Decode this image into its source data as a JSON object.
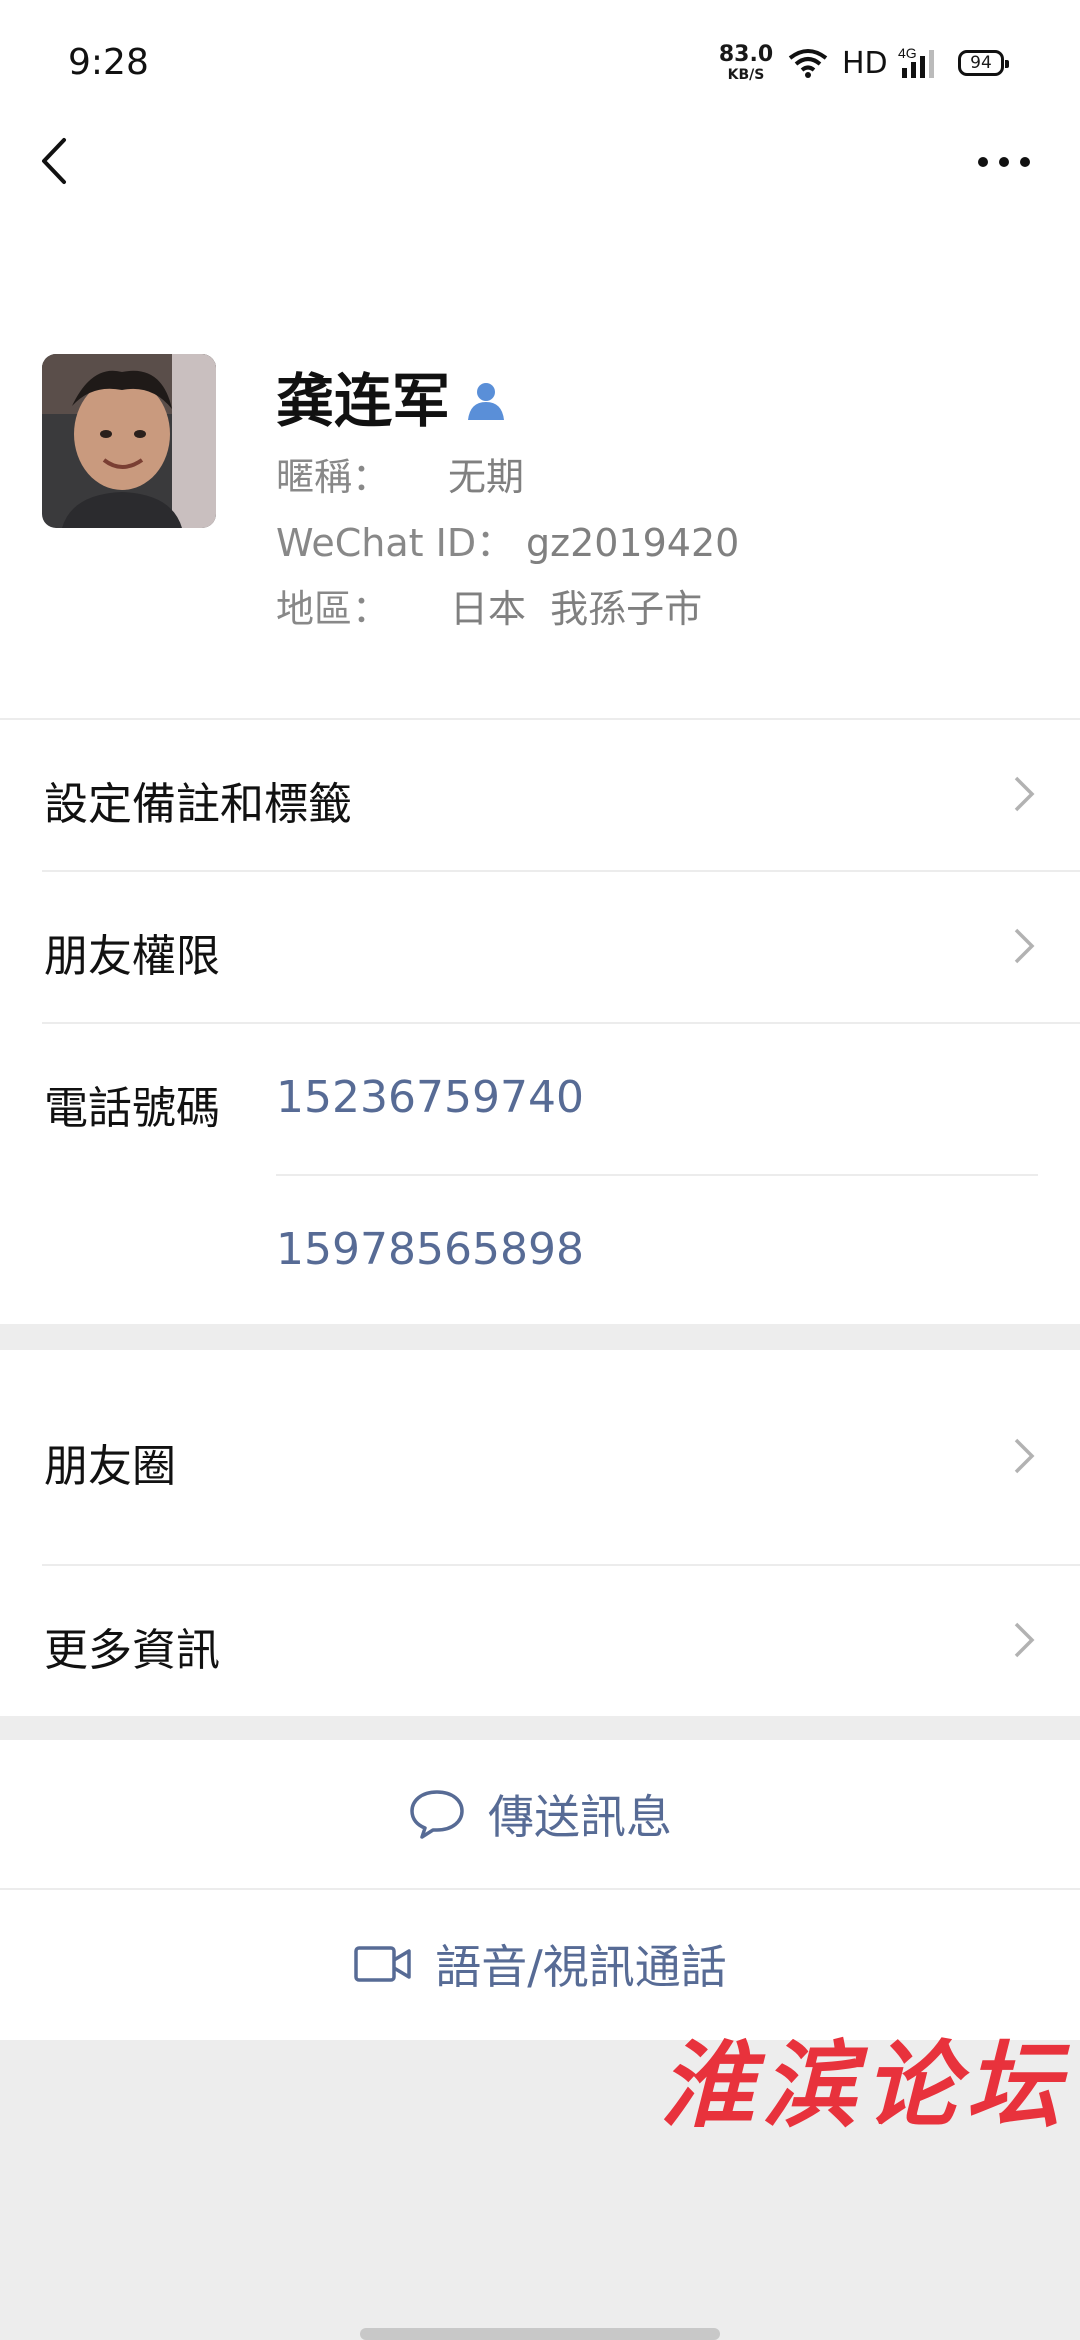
{
  "status_bar": {
    "time": "9:28",
    "net_speed_value": "83.0",
    "net_speed_unit": "KB/S",
    "hd": "HD",
    "network": "4G",
    "battery": "94"
  },
  "profile": {
    "name": "龚连军",
    "nickname_label": "暱稱：",
    "nickname": "无期",
    "wechat_id_label": "WeChat ID：",
    "wechat_id": "gz2019420",
    "region_label": "地區：",
    "region": "日本  我孫子市"
  },
  "menu": {
    "remarks_tags": "設定備註和標籤",
    "permissions": "朋友權限",
    "phone_label": "電話號碼",
    "phones": [
      "15236759740",
      "15978565898"
    ],
    "moments": "朋友圈",
    "more_info": "更多資訊"
  },
  "actions": {
    "send_message": "傳送訊息",
    "voice_video_call": "語音/視訊通話"
  },
  "watermark": "淮滨论坛",
  "colors": {
    "link_blue": "#576b95",
    "verify_blue": "#5a8fd8",
    "watermark_red": "#e8323c",
    "background": "#ededed"
  }
}
